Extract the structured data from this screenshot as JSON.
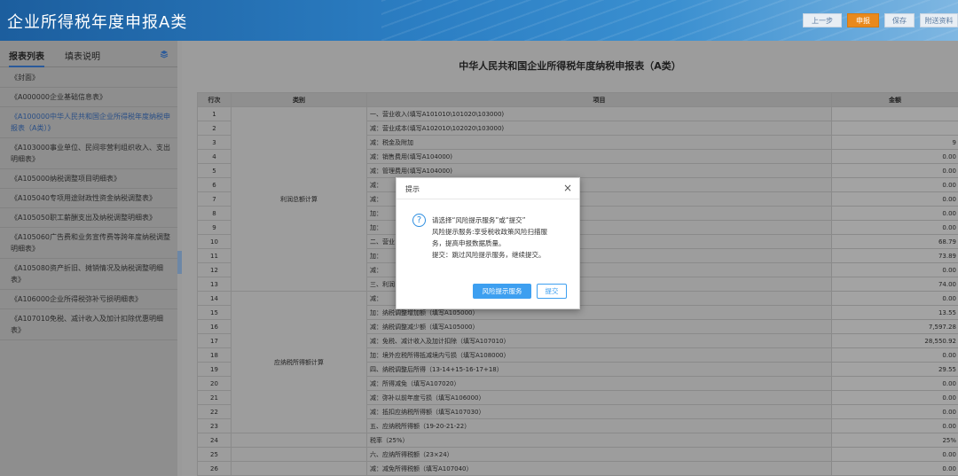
{
  "app": {
    "title": "企业所得税年度申报A类",
    "buttons": [
      {
        "label": "上一步"
      },
      {
        "label": "申报"
      },
      {
        "label": "保存"
      },
      {
        "label": "附送资料"
      }
    ]
  },
  "sidebar": {
    "tabs": [
      {
        "label": "报表列表",
        "active": true
      },
      {
        "label": "填表说明",
        "active": false
      }
    ],
    "items": [
      {
        "label": "《封面》"
      },
      {
        "label": "《A000000企业基础信息表》"
      },
      {
        "label": "《A100000中华人民共和国企业所得税年度纳税申报表（A类）》"
      },
      {
        "label": "《A103000事业单位、民间非营利组织收入、支出明细表》"
      },
      {
        "label": "《A105000纳税调整项目明细表》"
      },
      {
        "label": "《A105040专项用途财政性资金纳税调整表》"
      },
      {
        "label": "《A105050职工薪酬支出及纳税调整明细表》"
      },
      {
        "label": "《A105060广告费和业务宣传费等跨年度纳税调整明细表》"
      },
      {
        "label": "《A105080资产折旧、摊销情况及纳税调整明细表》"
      },
      {
        "label": "《A106000企业所得税弥补亏损明细表》"
      },
      {
        "label": "《A107010免税、减计收入及加计扣除优惠明细表》"
      }
    ]
  },
  "form": {
    "title": "中华人民共和国企业所得税年度纳税申报表（A类）",
    "headers": {
      "row": "行次",
      "category": "类别",
      "item": "项目",
      "amount": "金额"
    },
    "categories": {
      "profit": "利润总额计算",
      "taxable": "应纳税所得额计算"
    },
    "rows": [
      {
        "no": "1",
        "item": "一、营业收入(填写A101010\\101020\\103000)",
        "amount": ""
      },
      {
        "no": "2",
        "item": "减：营业成本(填写A102010\\102020\\103000)",
        "amount": ""
      },
      {
        "no": "3",
        "item": "减：税金及附加",
        "amount": "9"
      },
      {
        "no": "4",
        "item": "减：销售费用(填写A104000)",
        "amount": "0.00"
      },
      {
        "no": "5",
        "item": "减：管理费用(填写A104000)",
        "amount": "0.00"
      },
      {
        "no": "6",
        "item": "减：",
        "amount": "0.00"
      },
      {
        "no": "7",
        "item": "减：",
        "amount": "0.00"
      },
      {
        "no": "8",
        "item": "加：",
        "amount": "0.00"
      },
      {
        "no": "9",
        "item": "加：",
        "amount": "0.00"
      },
      {
        "no": "10",
        "item": "二、营业",
        "amount": "68.79"
      },
      {
        "no": "11",
        "item": "加：",
        "amount": "73.89"
      },
      {
        "no": "12",
        "item": "减：",
        "amount": "0.00"
      },
      {
        "no": "13",
        "item": "三、利润",
        "amount": "74.00"
      },
      {
        "no": "14",
        "item": "减：",
        "amount": "0.00"
      },
      {
        "no": "15",
        "item": "加：纳税调整增加额（填写A105000）",
        "amount": "13.55"
      },
      {
        "no": "16",
        "item": "减：纳税调整减少额（填写A105000）",
        "amount": "7,597.28"
      },
      {
        "no": "17",
        "item": "减：免税、减计收入及加计扣除（填写A107010）",
        "amount": "28,550.92"
      },
      {
        "no": "18",
        "item": "加：境外应税所得抵减境内亏损（填写A108000）",
        "amount": "0.00"
      },
      {
        "no": "19",
        "item": "四、纳税调整后所得（13-14+15-16-17+18）",
        "amount": "29.55"
      },
      {
        "no": "20",
        "item": "减：所得减免（填写A107020）",
        "amount": "0.00"
      },
      {
        "no": "21",
        "item": "减：弥补以前年度亏损（填写A106000）",
        "amount": "0.00"
      },
      {
        "no": "22",
        "item": "减：抵扣应纳税所得额（填写A107030）",
        "amount": "0.00"
      },
      {
        "no": "23",
        "item": "五、应纳税所得额（19-20-21-22）",
        "amount": "0.00"
      },
      {
        "no": "24",
        "item": "税率（25%）",
        "amount": "25%"
      },
      {
        "no": "25",
        "item": "六、应纳所得税额（23×24）",
        "amount": "0.00"
      },
      {
        "no": "26",
        "item": "减：减免所得税额（填写A107040）",
        "amount": "0.00"
      }
    ]
  },
  "dialog": {
    "title": "提示",
    "close": "×",
    "icon": "question-icon",
    "lines": [
      "请选择“风险提示服务”或“提交”",
      "风险提示服务:享受税收政策风险扫描服",
      "务，提高申报数据质量。",
      "提交：跳过风险提示服务，继续提交。"
    ],
    "primary_label": "风险提示服务",
    "secondary_label": "提交"
  }
}
